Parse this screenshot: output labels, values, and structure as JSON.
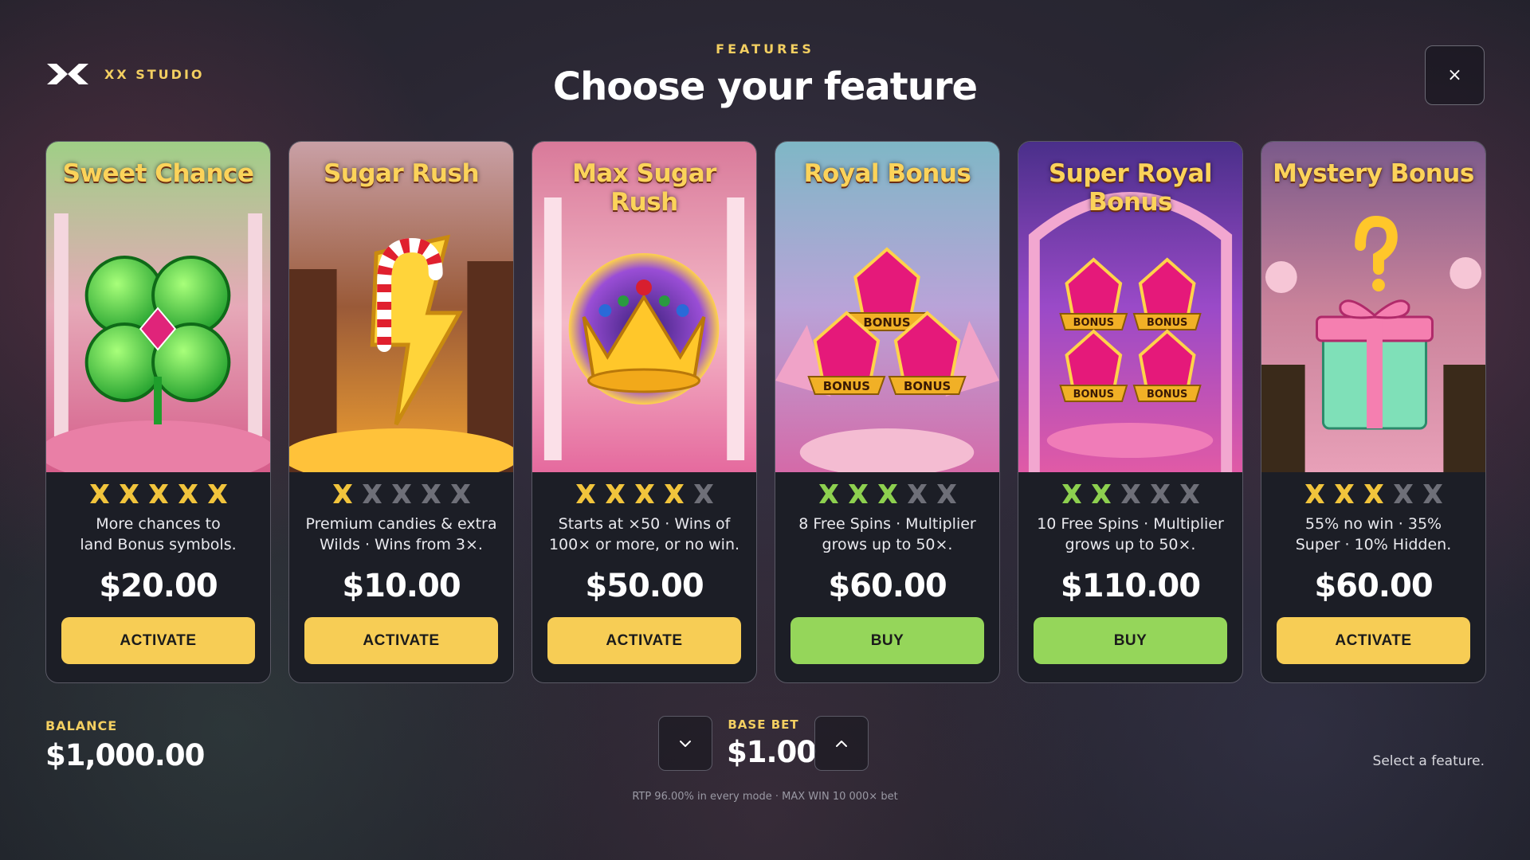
{
  "brand": {
    "name": "XX STUDIO",
    "logo_icon": "xx-logo-icon"
  },
  "header": {
    "eyebrow": "FEATURES",
    "title": "Choose your feature"
  },
  "close": {
    "icon": "close-icon",
    "label": "×"
  },
  "colors": {
    "accent_gold": "#f3cf61",
    "activate_button": "#f7cd55",
    "buy_button": "#95d65a",
    "rating_gold": "#f1c43c",
    "rating_green": "#8dd04f",
    "rating_empty": "#6e6f78"
  },
  "cards": [
    {
      "title": "Sweet Chance",
      "art": "four-leaf-clover-gem-icon",
      "rating": {
        "filled": 5,
        "total": 5,
        "color": "gold"
      },
      "desc_line1": "More chances to",
      "desc_line2": "land Bonus symbols.",
      "price": "$20.00",
      "action": "ACTIVATE",
      "action_type": "activate"
    },
    {
      "title": "Sugar Rush",
      "art": "candy-cane-lightning-icon",
      "rating": {
        "filled": 1,
        "total": 5,
        "color": "gold"
      },
      "desc_line1": "Premium candies & extra",
      "desc_line2": "Wilds · Wins from 3×.",
      "price": "$10.00",
      "action": "ACTIVATE",
      "action_type": "activate"
    },
    {
      "title": "Max Sugar Rush",
      "art": "golden-crown-icon",
      "rating": {
        "filled": 4,
        "total": 5,
        "color": "gold"
      },
      "desc_line1": "Starts at ×50 · Wins of",
      "desc_line2": "100× or more, or no win.",
      "price": "$50.00",
      "action": "ACTIVATE",
      "action_type": "activate"
    },
    {
      "title": "Royal Bonus",
      "art": "bonus-gems-three-icon",
      "gem_label": "BONUS",
      "rating": {
        "filled": 3,
        "total": 5,
        "color": "green"
      },
      "desc_line1": "8 Free Spins · Multiplier",
      "desc_line2": "grows up to 50×.",
      "price": "$60.00",
      "action": "BUY",
      "action_type": "buy"
    },
    {
      "title": "Super Royal Bonus",
      "art": "bonus-gems-four-icon",
      "gem_label": "BONUS",
      "rating": {
        "filled": 2,
        "total": 5,
        "color": "green"
      },
      "desc_line1": "10 Free Spins · Multiplier",
      "desc_line2": "grows up to 50×.",
      "price": "$110.00",
      "action": "BUY",
      "action_type": "buy"
    },
    {
      "title": "Mystery Bonus",
      "art": "mystery-gift-box-icon",
      "rating": {
        "filled": 3,
        "total": 5,
        "color": "gold"
      },
      "desc_line1": "55% no win · 35%",
      "desc_line2": "Super · 10% Hidden.",
      "price": "$60.00",
      "action": "ACTIVATE",
      "action_type": "activate"
    }
  ],
  "balance": {
    "label": "BALANCE",
    "value": "$1,000.00"
  },
  "bet": {
    "label": "BASE BET",
    "value": "$1.00",
    "decrease_icon": "chevron-down-icon",
    "increase_icon": "chevron-up-icon"
  },
  "status_hint": "Select a feature.",
  "footer_note": "RTP 96.00% in every mode · MAX WIN 10 000× bet"
}
